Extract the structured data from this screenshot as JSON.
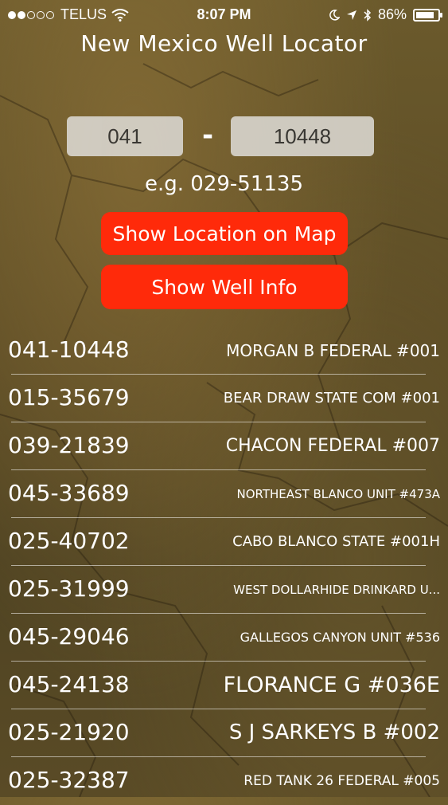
{
  "status_bar": {
    "carrier": "TELUS",
    "time": "8:07 PM",
    "battery": "86%",
    "battery_level": 0.86,
    "signal_filled": 2,
    "signal_total": 5
  },
  "title": "New Mexico Well Locator",
  "inputs": {
    "county_code": "041",
    "separator": "-",
    "well_number": "10448",
    "example": "e.g. 029-51135"
  },
  "buttons": {
    "show_location": "Show Location on Map",
    "show_info": "Show Well Info"
  },
  "wells": [
    {
      "api": "041-10448",
      "name": "MORGAN B FEDERAL #001"
    },
    {
      "api": "015-35679",
      "name": "BEAR DRAW STATE COM #001"
    },
    {
      "api": "039-21839",
      "name": "CHACON FEDERAL #007"
    },
    {
      "api": "045-33689",
      "name": "NORTHEAST BLANCO UNIT #473A"
    },
    {
      "api": "025-40702",
      "name": "CABO BLANCO STATE #001H"
    },
    {
      "api": "025-31999",
      "name": "WEST DOLLARHIDE DRINKARD U..."
    },
    {
      "api": "045-29046",
      "name": "GALLEGOS CANYON UNIT #536"
    },
    {
      "api": "045-24138",
      "name": "FLORANCE G #036E"
    },
    {
      "api": "025-21920",
      "name": "S J SARKEYS B #002"
    },
    {
      "api": "025-32387",
      "name": "RED TANK 26 FEDERAL #005"
    }
  ],
  "colors": {
    "button": "#ff2a0a",
    "field": "#d9d6cf"
  }
}
